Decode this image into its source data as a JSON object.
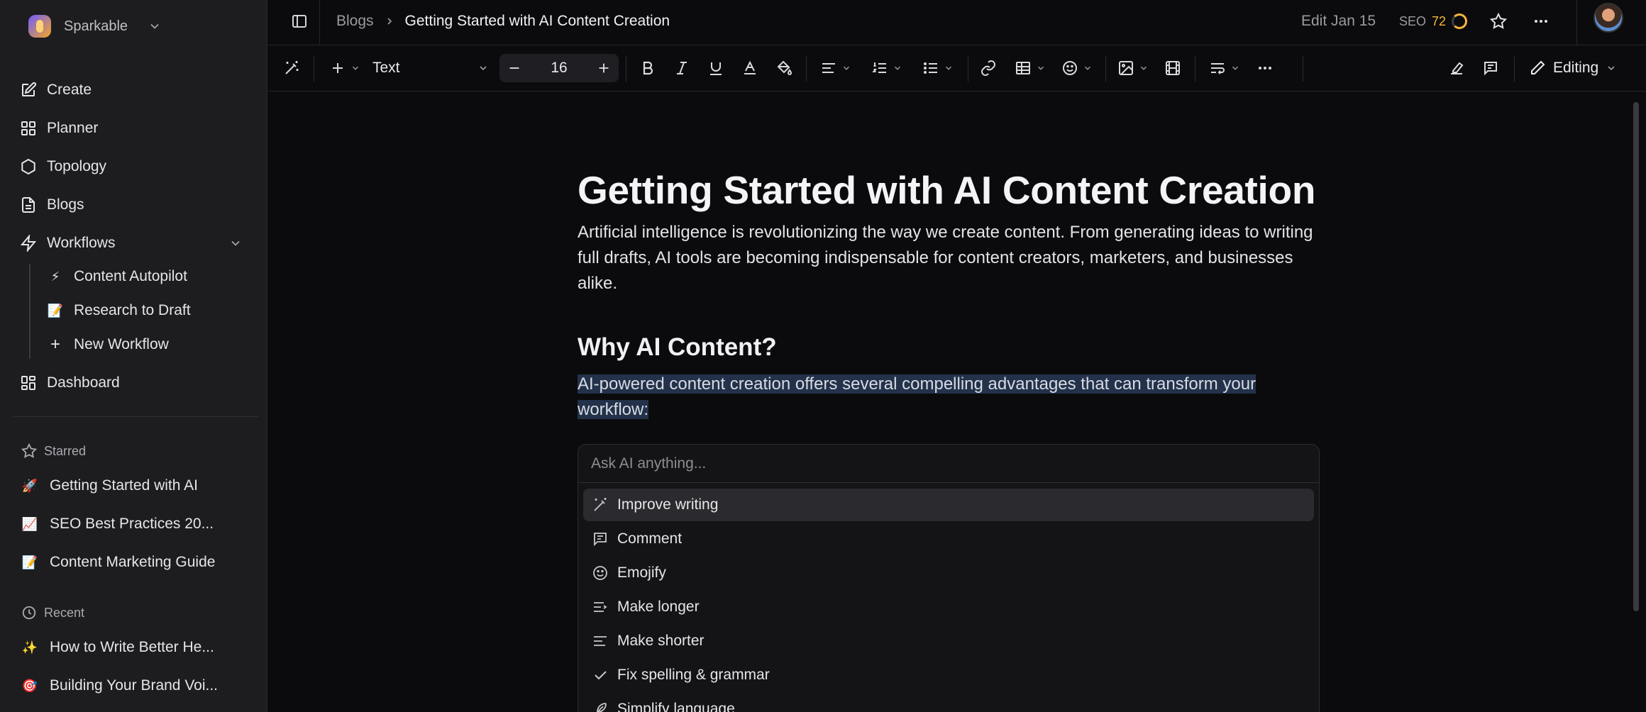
{
  "brand": {
    "name": "Sparkable"
  },
  "sidebar": {
    "nav": [
      {
        "label": "Create",
        "icon": "edit-square-icon"
      },
      {
        "label": "Planner",
        "icon": "grid-icon"
      },
      {
        "label": "Topology",
        "icon": "hexagon-icon"
      },
      {
        "label": "Blogs",
        "icon": "document-icon"
      },
      {
        "label": "Workflows",
        "icon": "bolt-icon"
      }
    ],
    "workflows": [
      {
        "emoji": "⚡",
        "label": "Content Autopilot"
      },
      {
        "emoji": "📝",
        "label": "Research to Draft"
      },
      {
        "emoji": "+",
        "label": "New Workflow"
      }
    ],
    "dashboard": "Dashboard",
    "starred_title": "Starred",
    "starred": [
      {
        "emoji": "🚀",
        "label": "Getting Started with AI"
      },
      {
        "emoji": "📈",
        "label": "SEO Best Practices 20..."
      },
      {
        "emoji": "📝",
        "label": "Content Marketing Guide"
      }
    ],
    "recent_title": "Recent",
    "recent": [
      {
        "emoji": "✨",
        "label": "How to Write Better He..."
      },
      {
        "emoji": "🎯",
        "label": "Building Your Brand Voi..."
      }
    ]
  },
  "topbar": {
    "breadcrumb_parent": "Blogs",
    "breadcrumb_current": "Getting Started with AI Content Creation",
    "edit_date": "Edit Jan 15",
    "seo_label": "SEO",
    "seo_score": "72"
  },
  "toolbar": {
    "text_style": "Text",
    "font_size": "16",
    "mode": "Editing"
  },
  "document": {
    "title": "Getting Started with AI Content Creation",
    "lead": "Artificial intelligence is revolutionizing the way we create content. From generating ideas to writing full drafts, AI tools are becoming indispensable for content creators, marketers, and businesses alike.",
    "heading": "Why AI Content?",
    "selected_line_1": "AI-powered content creation offers several compelling advantages that can transform your",
    "selected_line_2": "workflow:"
  },
  "ai_menu": {
    "placeholder": "Ask AI anything...",
    "items": [
      {
        "label": "Improve writing",
        "icon": "magic-wand-icon"
      },
      {
        "label": "Comment",
        "icon": "comment-icon"
      },
      {
        "label": "Emojify",
        "icon": "smiley-icon"
      },
      {
        "label": "Make longer",
        "icon": "lines-longer-icon"
      },
      {
        "label": "Make shorter",
        "icon": "lines-shorter-icon"
      },
      {
        "label": "Fix spelling & grammar",
        "icon": "check-icon"
      },
      {
        "label": "Simplify language",
        "icon": "feather-icon"
      }
    ]
  }
}
